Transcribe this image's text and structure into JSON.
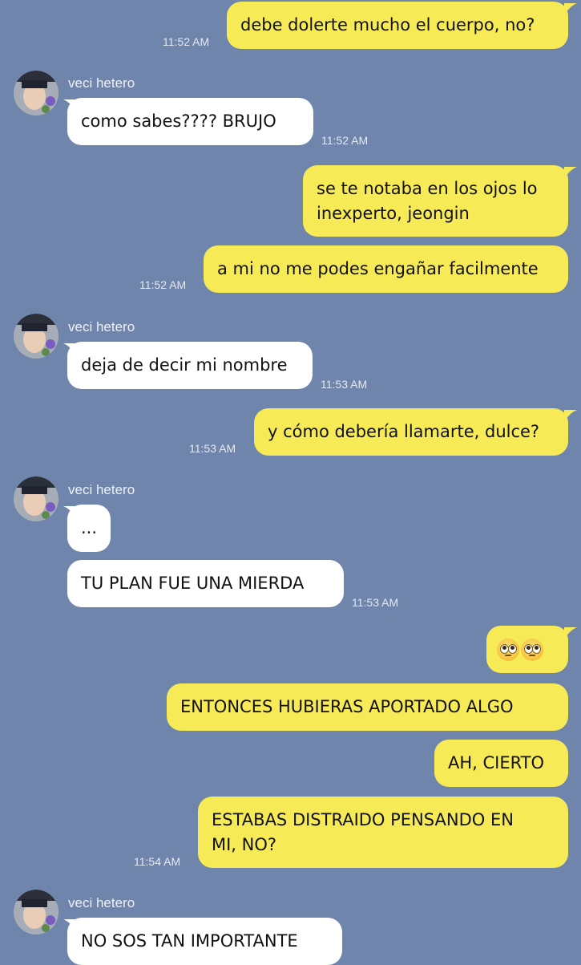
{
  "contact": {
    "name": "veci hetero"
  },
  "messages": {
    "m1": {
      "text": "debe dolerte mucho el cuerpo, no?",
      "time": "11:52 AM"
    },
    "m2": {
      "text": "como sabes???? BRUJO",
      "time": "11:52 AM"
    },
    "m3": {
      "line1": "se te notaba en los ojos lo",
      "line2": "inexperto, jeongin"
    },
    "m4": {
      "text": "a mi no me podes engañar facilmente",
      "time": "11:52 AM"
    },
    "m5": {
      "text": "deja de decir mi nombre",
      "time": "11:53 AM"
    },
    "m6": {
      "text": "y cómo debería llamarte, dulce?",
      "time": "11:53 AM"
    },
    "m7": {
      "text": "..."
    },
    "m8": {
      "text": "TU PLAN FUE UNA MIERDA",
      "time": "11:53 AM"
    },
    "m9": {
      "emoji": "face-with-rolling-eyes x2"
    },
    "m10": {
      "text": "ENTONCES HUBIERAS APORTADO ALGO"
    },
    "m11": {
      "text": "AH, CIERTO"
    },
    "m12": {
      "line1": "ESTABAS DISTRAIDO PENSANDO EN",
      "line2": "MI, NO?",
      "time": "11:54 AM"
    },
    "m13": {
      "text": "NO SOS TAN IMPORTANTE"
    }
  },
  "colors": {
    "background": "#7085ab",
    "outgoing_bubble": "#f7ea57",
    "incoming_bubble": "#ffffff"
  }
}
